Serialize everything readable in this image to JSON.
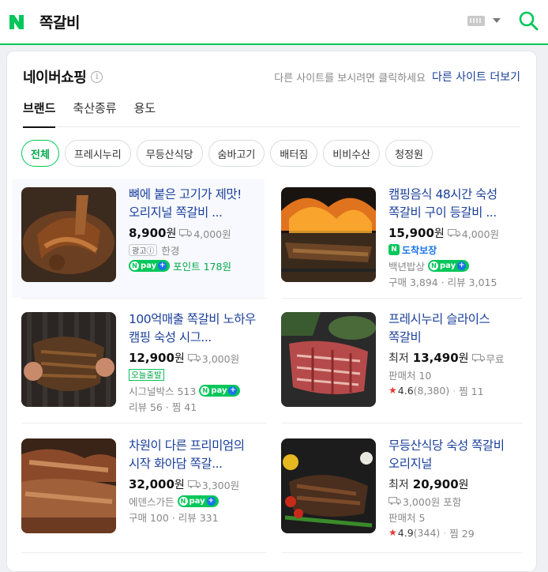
{
  "search": {
    "query": "쪽갈비"
  },
  "panel": {
    "title": "네이버쇼핑",
    "hint": "다른 사이트를 보시려면 클릭하세요",
    "more_link": "다른 사이트 더보기",
    "tabs": [
      "브랜드",
      "축산종류",
      "용도"
    ],
    "chips": [
      "전체",
      "프레시누리",
      "무등산식당",
      "숨바고기",
      "배터짐",
      "비비수산",
      "청정원"
    ]
  },
  "products": [
    {
      "title": "뼈에 붙은 고기가 제맛! 오리지널 쪽갈비 ...",
      "price": "8,900",
      "won": "원",
      "ship": "4,000원",
      "ad": "광고ⓘ",
      "seller": "한경",
      "point": "포인트 178원"
    },
    {
      "title": "캠핑음식 48시간 숙성 쪽갈비 구이 등갈비 ...",
      "price": "15,900",
      "won": "원",
      "ship": "4,000원",
      "arrival": "도착보장",
      "seller": "백년밥상",
      "stats": "구매 3,894 · 리뷰 3,015"
    },
    {
      "title": "100억매출 쪽갈비 노하우 캠핑 숙성 시그...",
      "price": "12,900",
      "won": "원",
      "ship": "3,000원",
      "early": "오늘출발",
      "seller": "시그널박스 513",
      "stats": "리뷰 56 · 찜 41"
    },
    {
      "title": "프레시누리 슬라이스 쪽갈비",
      "prefix": "최저",
      "price": "13,490",
      "won": "원",
      "ship": "무료",
      "sellers": "판매처 10",
      "rating": "4.6",
      "reviews": "(8,380)",
      "zzim": "찜 11"
    },
    {
      "title": "차원이 다른 프리미엄의 시작 화아담 쪽갈...",
      "price": "32,000",
      "won": "원",
      "ship": "3,300원",
      "seller": "에덴스가든",
      "stats": "구매 100 · 리뷰 331"
    },
    {
      "title": "무등산식당 숙성 쪽갈비 오리지널",
      "prefix": "최저",
      "price": "20,900",
      "won": "원",
      "ship": "3,000원 포함",
      "sellers": "판매처 5",
      "rating": "4.9",
      "reviews": "(344)",
      "zzim": "찜 29"
    }
  ],
  "npay_label": "pay",
  "colors": {
    "brand_green": "#03c75a",
    "link_blue": "#1a3f9a"
  }
}
